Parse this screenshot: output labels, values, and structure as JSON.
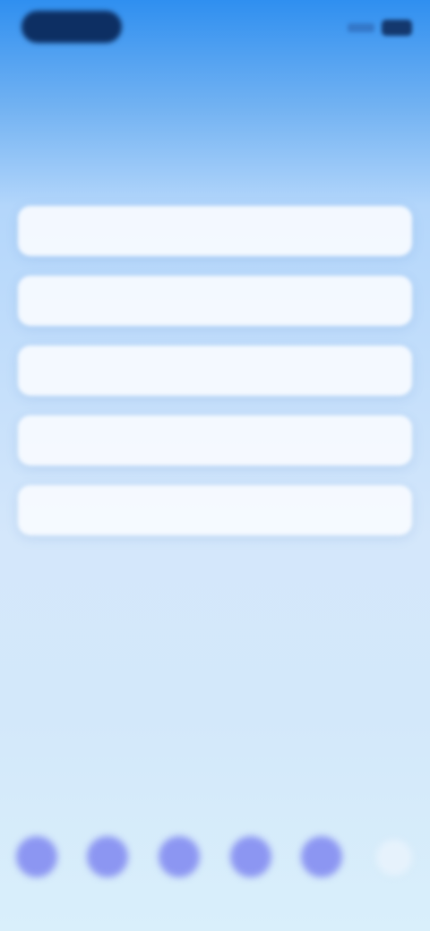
{
  "status_bar": {
    "time": "",
    "sub_left": "",
    "sub_right": ""
  },
  "question": {
    "subtitle": "",
    "text": ""
  },
  "options": [
    {
      "label": ""
    },
    {
      "label": ""
    },
    {
      "label": ""
    },
    {
      "label": ""
    },
    {
      "label": ""
    }
  ],
  "bottom_bar": {
    "items": [
      {
        "label": "",
        "icon": "circle-icon"
      },
      {
        "label": "",
        "icon": "circle-icon"
      },
      {
        "label": "",
        "icon": "circle-icon"
      },
      {
        "label": "",
        "icon": "circle-icon"
      },
      {
        "label": "",
        "icon": "circle-icon"
      }
    ]
  },
  "colors": {
    "accent": "#8c96f2",
    "top_gradient": "#2f8ff0",
    "bottom_gradient": "#d9effb",
    "option_background": "#f7fbff"
  }
}
